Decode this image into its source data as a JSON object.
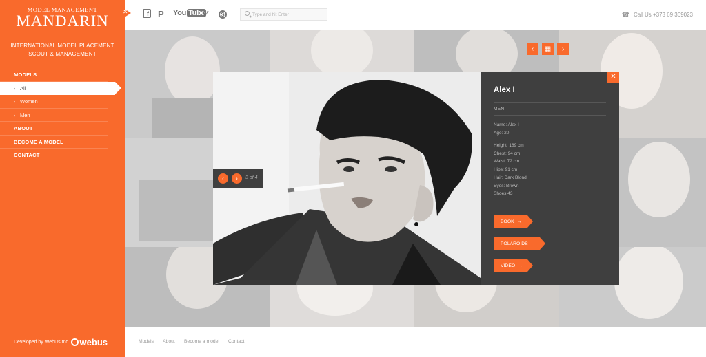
{
  "brand": {
    "sub": "MODEL MANAGEMENT",
    "name": "MANDARIN",
    "tagline_line1": "INTERNATIONAL MODEL PLACEMENT",
    "tagline_line2": "SCOUT & MANAGEMENT"
  },
  "nav": {
    "models": "MODELS",
    "sub": [
      {
        "label": "All",
        "active": true
      },
      {
        "label": "Women",
        "active": false
      },
      {
        "label": "Men",
        "active": false
      }
    ],
    "about": "ABOUT",
    "become": "BECOME A MODEL",
    "contact": "CONTACT"
  },
  "sidebar_footer": {
    "developed": "Developed by WebUs.md",
    "logo": "webus"
  },
  "topbar": {
    "search_placeholder": "Type and hit Enter",
    "call": "Call Us  +373 69 369023",
    "social": {
      "facebook": "f",
      "pinterest": "P",
      "youtube_a": "You",
      "youtube_b": "Tube",
      "vimeo": "V",
      "skype": "S"
    }
  },
  "modal": {
    "name": "Alex I",
    "category": "MEN",
    "details_basic": [
      "Name: Alex I",
      "Age: 20"
    ],
    "details_measure": [
      "Height: 189 cm",
      "Chest: 94 cm",
      "Waist: 72 cm",
      "Hips: 91 cm",
      "Hair: Dark Blond",
      "Eyes: Brown",
      "Shoes:43"
    ],
    "buttons": {
      "book": "BOOK",
      "polaroids": "POLAROIDS",
      "video": "VIDEO"
    },
    "counter": "3 of 4"
  },
  "footer": {
    "links": [
      "Models",
      "About",
      "Become a model",
      "Contact"
    ]
  },
  "colors": {
    "accent": "#f96a2c",
    "panel": "#3f3f3f"
  },
  "icons": {
    "arrow": "→",
    "prev": "‹",
    "next": "›",
    "close": "✕",
    "grid": "▦",
    "phone": "☎"
  }
}
